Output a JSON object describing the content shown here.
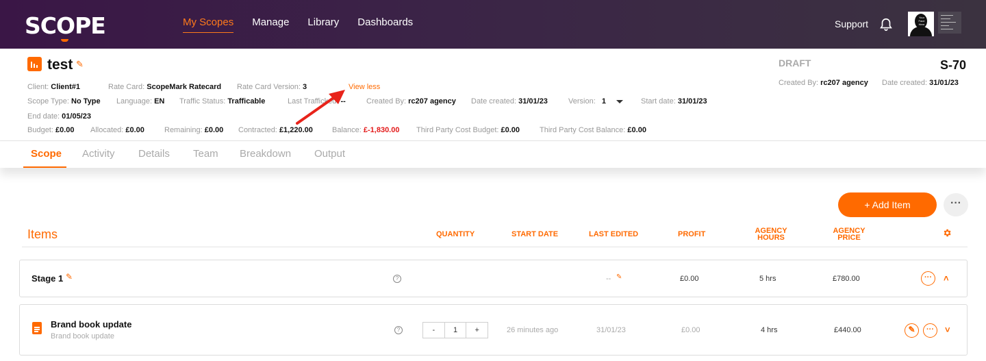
{
  "app": {
    "logo": "SCOPE"
  },
  "nav": {
    "items": [
      "My Scopes",
      "Manage",
      "Library",
      "Dashboards"
    ],
    "active_index": 0,
    "support": "Support"
  },
  "avatar": {
    "text": "Your Face Here"
  },
  "scope": {
    "title": "test",
    "status": "DRAFT",
    "id": "S-70",
    "view_toggle": "View less",
    "created_by_label": "Created By:",
    "created_by": "rc207 agency",
    "date_created_label": "Date created:",
    "date_created": "31/01/23"
  },
  "meta": {
    "client_label": "Client:",
    "client": "Client#1",
    "rate_card_label": "Rate Card:",
    "rate_card": "ScopeMark Ratecard",
    "rate_card_version_label": "Rate Card Version:",
    "rate_card_version": "3",
    "scope_type_label": "Scope Type:",
    "scope_type": "No Type",
    "language_label": "Language:",
    "language": "EN",
    "traffic_status_label": "Traffic Status:",
    "traffic_status": "Trafficable",
    "last_trafficked_label": "Last Trafficked:",
    "last_trafficked": "--",
    "created_by_label": "Created By:",
    "created_by": "rc207 agency",
    "date_created_label": "Date created:",
    "date_created": "31/01/23",
    "version_label": "Version:",
    "version": "1",
    "start_date_label": "Start date:",
    "start_date": "31/01/23",
    "end_date_label": "End date:",
    "end_date": "01/05/23",
    "budget_label": "Budget:",
    "budget": "£0.00",
    "allocated_label": "Allocated:",
    "allocated": "£0.00",
    "remaining_label": "Remaining:",
    "remaining": "£0.00",
    "contracted_label": "Contracted:",
    "contracted": "£1,220.00",
    "balance_label": "Balance:",
    "balance": "£-1,830.00",
    "tp_budget_label": "Third Party Cost Budget:",
    "tp_budget": "£0.00",
    "tp_balance_label": "Third Party Cost Balance:",
    "tp_balance": "£0.00"
  },
  "tabs": [
    "Scope",
    "Activity",
    "Details",
    "Team",
    "Breakdown",
    "Output"
  ],
  "toolbar": {
    "add_item": "+ Add Item",
    "more": "···"
  },
  "items": {
    "label": "Items",
    "columns": {
      "quantity": "QUANTITY",
      "start_date": "START DATE",
      "last_edited": "LAST EDITED",
      "profit": "PROFIT",
      "agency_hours_1": "AGENCY",
      "agency_hours_2": "HOURS",
      "agency_price_1": "AGENCY",
      "agency_price_2": "PRICE"
    }
  },
  "stage": {
    "name": "Stage 1",
    "last_edited": "--",
    "profit": "£0.00",
    "hours": "5 hrs",
    "price": "£780.00"
  },
  "deliverable": {
    "name": "Brand book update",
    "description": "Brand book update",
    "quantity": "1",
    "minus": "-",
    "plus": "+",
    "start_date": "26 minutes ago",
    "last_edited": "31/01/23",
    "profit": "£0.00",
    "hours": "4 hrs",
    "price": "£440.00"
  },
  "colors": {
    "accent": "#ff6a00",
    "negative": "#e31b1b",
    "nav_bg": "#3a1646"
  }
}
